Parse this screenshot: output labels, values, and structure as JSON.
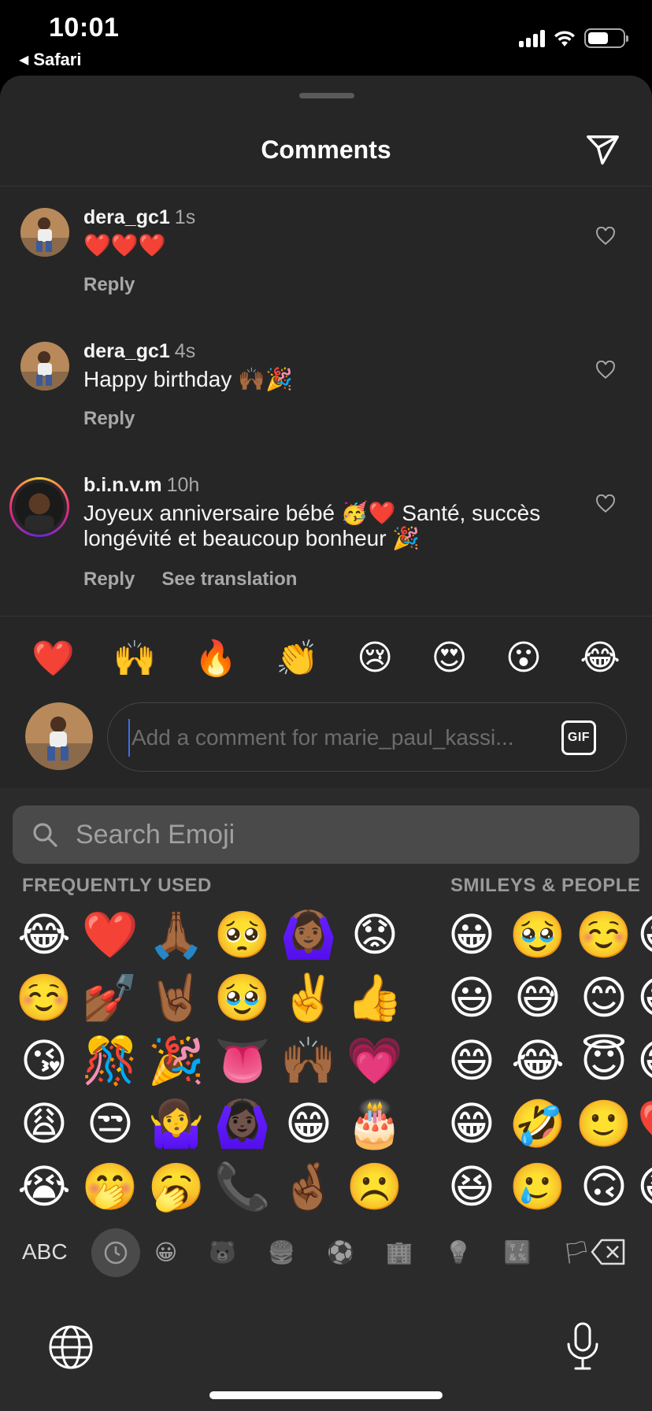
{
  "status_bar": {
    "time": "10:01",
    "back_app": "Safari",
    "battery_level": 0.6
  },
  "sheet": {
    "title": "Comments"
  },
  "comments": [
    {
      "username": "dera_gc1",
      "time": "1s",
      "text": "❤️❤️❤️",
      "reply": "Reply",
      "translate": ""
    },
    {
      "username": "dera_gc1",
      "time": "4s",
      "text": "Happy birthday 🙌🏾🎉",
      "reply": "Reply",
      "translate": ""
    },
    {
      "username": "b.i.n.v.m",
      "time": "10h",
      "text": "Joyeux anniversaire bébé 🥳❤️ Santé, succès longévité et beaucoup bonheur 🎉",
      "reply": "Reply",
      "translate": "See translation"
    }
  ],
  "quick_reactions": [
    "❤️",
    "🙌",
    "🔥",
    "👏",
    "😢",
    "😍",
    "😮",
    "😂"
  ],
  "composer": {
    "placeholder": "Add a comment for marie_paul_kassi...",
    "gif_label": "GIF"
  },
  "keyboard": {
    "search_placeholder": "Search Emoji",
    "section_frequent": "FREQUENTLY USED",
    "section_smileys": "SMILEYS & PEOPLE",
    "frequent": [
      "😂",
      "❤️",
      "🙏🏾",
      "🥺",
      "🙆🏾‍♀️",
      "😟",
      "☺️",
      "💅🏾",
      "🤘🏾",
      "🥹",
      "✌️",
      "👍",
      "😘",
      "🎊",
      "🎉",
      "👅",
      "🙌🏾",
      "💗",
      "😩",
      "😒",
      "🤷‍♀️",
      "🙆🏿‍♀️",
      "😁",
      "🎂",
      "😭",
      "🤭",
      "🥱",
      "📞",
      "🤞🏾",
      "☹️"
    ],
    "smileys": [
      "😀",
      "🥹",
      "☺️",
      "😀",
      "😃",
      "😅",
      "😊",
      "😃",
      "😄",
      "😂",
      "😇",
      "😄",
      "😁",
      "🤣",
      "🙂",
      "❤️",
      "😆",
      "🥲",
      "🙃",
      "😆"
    ],
    "abc_label": "ABC",
    "category_icons": [
      "😀",
      "🐻",
      "🍔",
      "⚽",
      "🏢",
      "💡",
      "🔣",
      "🏳"
    ]
  }
}
